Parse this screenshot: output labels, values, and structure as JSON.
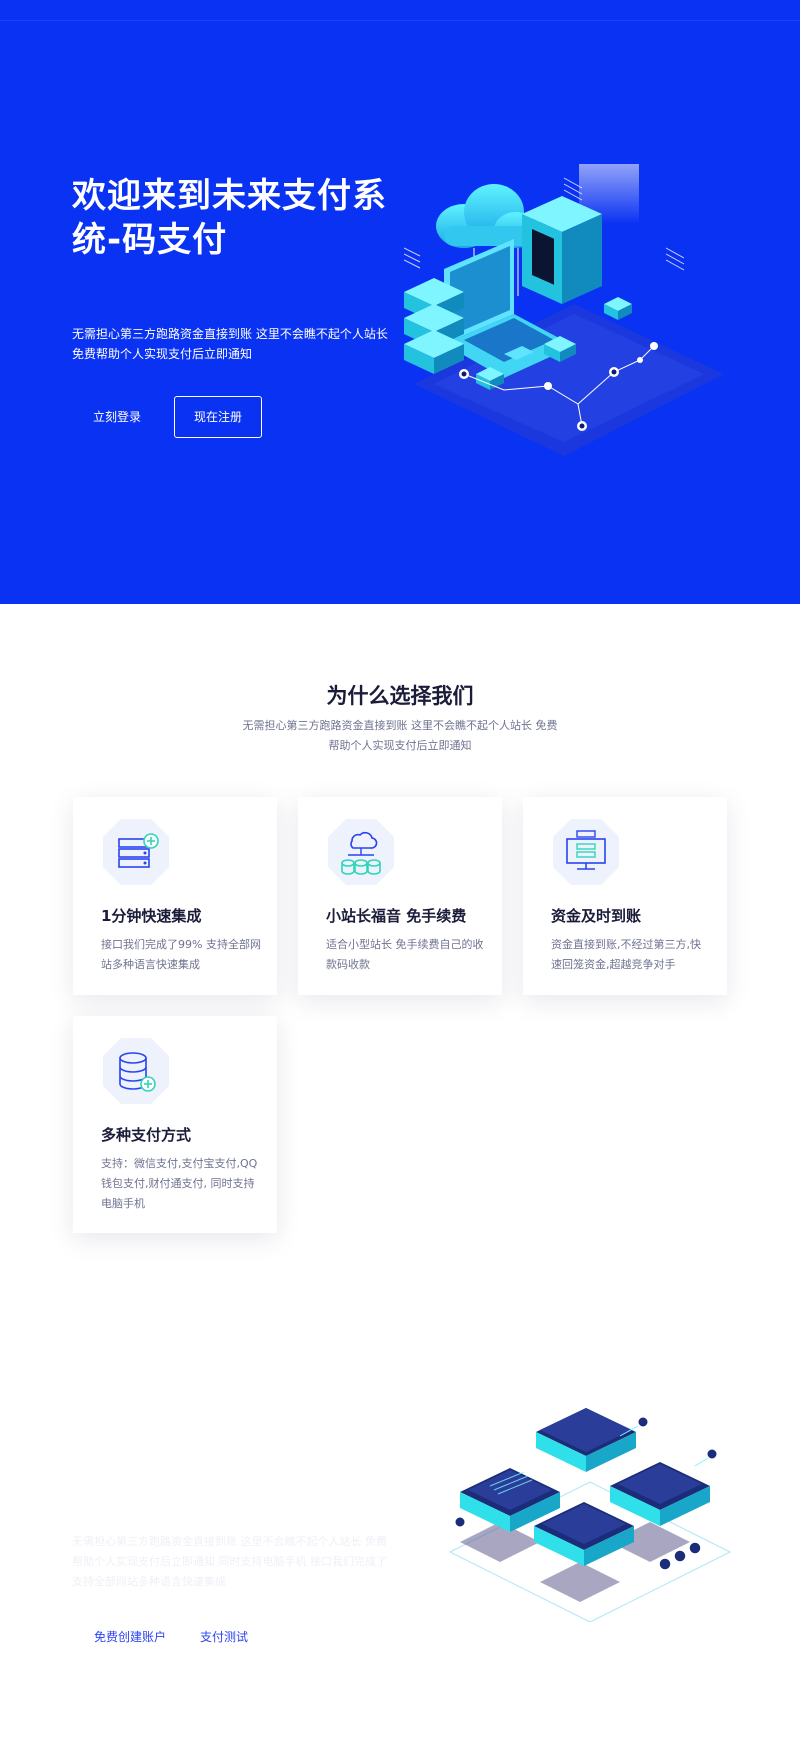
{
  "hero": {
    "title": "欢迎来到未来支付系统-码支付",
    "description": "无需担心第三方跑路资金直接到账 这里不会瞧不起个人站长 免费帮助个人实现支付后立即通知",
    "login_label": "立刻登录",
    "register_label": "现在注册",
    "bg_color": "#0a32f2"
  },
  "why": {
    "title": "为什么选择我们",
    "subtitle": "无需担心第三方跑路资金直接到账 这里不会瞧不起个人站长 免费帮助个人实现支付后立即通知",
    "cards": [
      {
        "icon": "server-add-icon",
        "title": "1分钟快速集成",
        "desc": "接口我们完成了99% 支持全部网站多种语言快速集成"
      },
      {
        "icon": "cloud-database-icon",
        "title": "小站长福音 免手续费",
        "desc": "适合小型站长 免手续费自己的收款码收款"
      },
      {
        "icon": "monitor-server-icon",
        "title": "资金及时到账",
        "desc": "资金直接到账,不经过第三方,快速回笼资金,超越竞争对手"
      },
      {
        "icon": "database-add-icon",
        "title": "多种支付方式",
        "desc": "支持：微信支付,支付宝支付,QQ钱包支付,财付通支付, 同时支持电脑手机"
      }
    ]
  },
  "bottom": {
    "faded_text": "无需担心第三方跑路资金直接到账 这里不会瞧不起个人站长 免费帮助个人实现支付后立即通知 同时支持电脑手机 接口我们完成了 支持全部网站多种语言快速集成",
    "create_account_label": "免费创建账户",
    "pay_test_label": "支付测试"
  }
}
